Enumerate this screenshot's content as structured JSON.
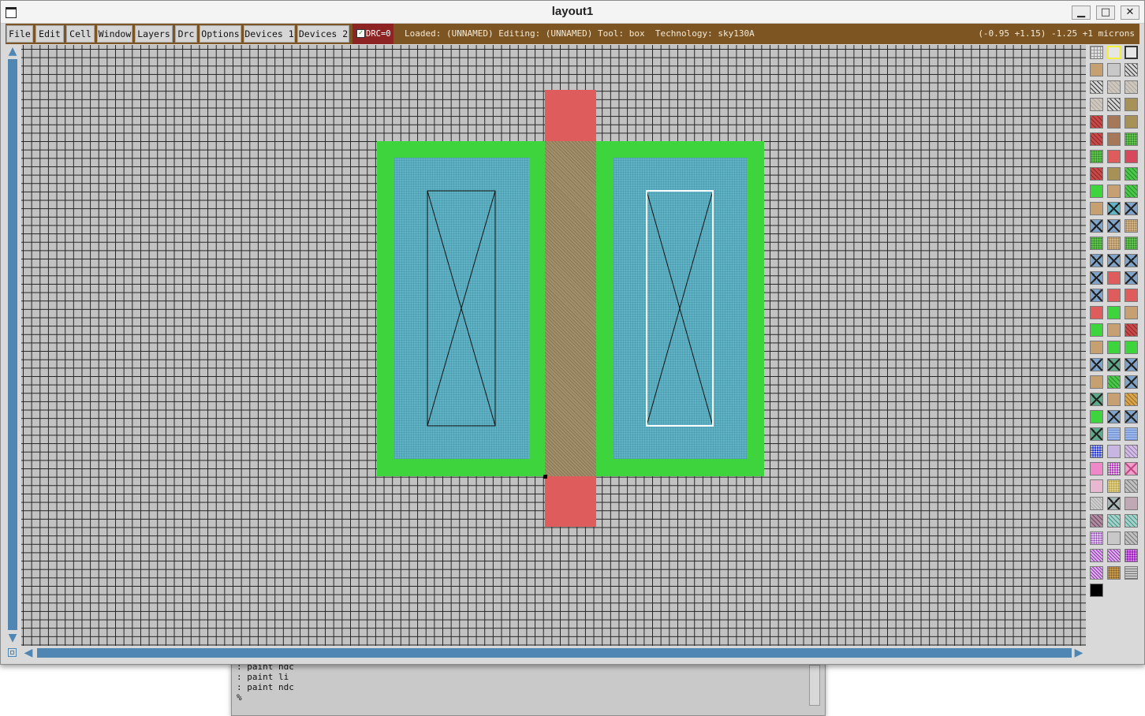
{
  "window": {
    "title": "layout1",
    "minimize_label": "▁",
    "maximize_label": "□",
    "close_label": "✕"
  },
  "menu": [
    "File",
    "Edit",
    "Cell",
    "Window",
    "Layers",
    "Drc",
    "Options",
    "Devices 1",
    "Devices 2"
  ],
  "drc": {
    "label": "DRC=0",
    "checked": true
  },
  "status": {
    "text": "Loaded: (UNNAMED) Editing: (UNNAMED) Tool: box  Technology: sky130A",
    "coords": "(-0.95 +1.15) -1.25 +1 microns"
  },
  "colors": {
    "menubar": "#7d5522",
    "drc_bg": "#8d2323",
    "diffusion": "#3ed43e",
    "poly": "#df5c5c",
    "local_interconnect": "#5fb5c6",
    "scroll": "#4f86b4"
  },
  "layout": {
    "layers": [
      "ndiff",
      "poly",
      "ntransistor",
      "li",
      "ndc"
    ]
  },
  "console": {
    "lines": [
      ": paint ndc",
      ": paint li",
      ": paint ndc",
      "%"
    ]
  },
  "palette": {
    "swatches": [
      "grid",
      "yellow-outline",
      "box",
      "tan",
      "gray",
      "hatch",
      "hatch",
      "tan-light",
      "tan-light",
      "tan-light",
      "hatch",
      "olive",
      "red-hatch",
      "brown",
      "olive",
      "red-hatch",
      "brown",
      "green-dots",
      "green-dots",
      "red",
      "red-pink",
      "red-hatch",
      "olive",
      "green-hatch",
      "green",
      "tan",
      "green-hatch",
      "tan",
      "contact-blue",
      "contact",
      "contact",
      "contact",
      "tan-dots",
      "green-dots",
      "tan-dots",
      "green-dots",
      "contact",
      "contact",
      "contact",
      "contact",
      "red",
      "contact",
      "contact",
      "red",
      "red",
      "red",
      "green",
      "tan",
      "green",
      "tan",
      "red-hatch",
      "tan",
      "green",
      "green",
      "contact",
      "contact-green",
      "contact",
      "tan",
      "green-hatch",
      "contact",
      "contact-green",
      "tan",
      "orange-hatch",
      "green",
      "contact",
      "contact",
      "contact-green",
      "blue-light",
      "blue-light",
      "blue-dense",
      "lavender",
      "lavender-hatch",
      "pink",
      "purple-dense",
      "pink-x",
      "pink-light",
      "yellow-dots",
      "gray-hatch",
      "gray-light",
      "contact-gray",
      "pink-gray",
      "pink-gray-hatch",
      "teal-hatch",
      "teal-hatch",
      "purple-dots",
      "gray",
      "gray-hatch",
      "purple-hatch",
      "purple-hatch",
      "purple-solid",
      "purple-hatch",
      "orange-dense",
      "gray-lines",
      "black"
    ]
  }
}
